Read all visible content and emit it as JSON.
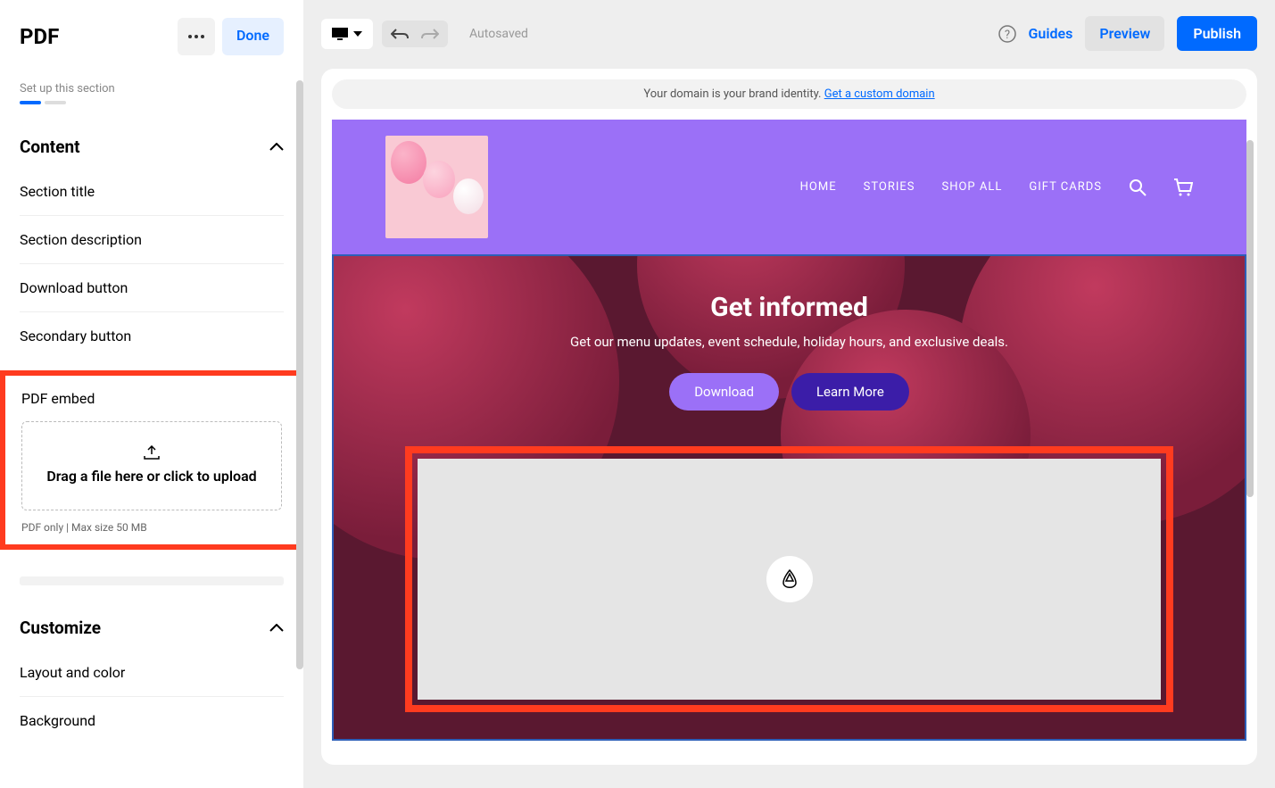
{
  "sidebar": {
    "title": "PDF",
    "more_label": "•••",
    "done_label": "Done",
    "setup_label": "Set up this section",
    "groups": {
      "content": {
        "title": "Content",
        "items": [
          "Section title",
          "Section description",
          "Download button",
          "Secondary button"
        ],
        "pdf_embed": {
          "label": "PDF embed",
          "dropzone_text": "Drag a file here or click to upload",
          "hint": "PDF only   |   Max size 50 MB"
        }
      },
      "customize": {
        "title": "Customize",
        "items": [
          "Layout and color",
          "Background"
        ]
      }
    }
  },
  "toolbar": {
    "autosaved": "Autosaved",
    "guides": "Guides",
    "preview": "Preview",
    "publish": "Publish"
  },
  "preview": {
    "domain_banner_text": "Your domain is your brand identity. ",
    "domain_banner_link": "Get a custom domain",
    "nav": [
      "HOME",
      "STORIES",
      "SHOP ALL",
      "GIFT CARDS"
    ],
    "hero": {
      "title": "Get informed",
      "subtitle": "Get our menu updates, event schedule, holiday hours, and exclusive deals.",
      "download": "Download",
      "learn_more": "Learn More"
    }
  }
}
